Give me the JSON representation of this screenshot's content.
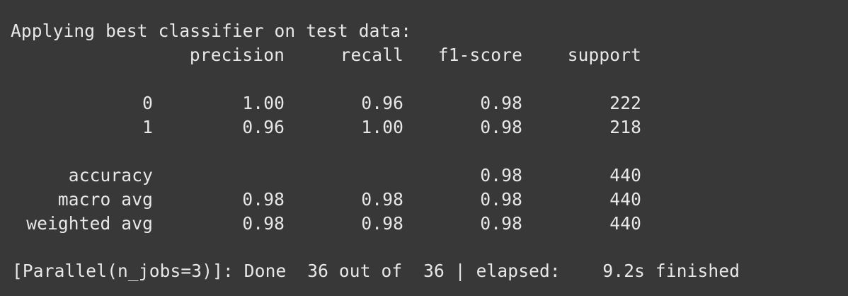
{
  "heading": "Applying best classifier on test data:",
  "report": {
    "columns": [
      "precision",
      "recall",
      "f1-score",
      "support"
    ],
    "rows": [
      {
        "label": "0",
        "precision": "1.00",
        "recall": "0.96",
        "f1": "0.98",
        "support": "222"
      },
      {
        "label": "1",
        "precision": "0.96",
        "recall": "1.00",
        "f1": "0.98",
        "support": "218"
      },
      {
        "label": "accuracy",
        "precision": "",
        "recall": "",
        "f1": "0.98",
        "support": "440"
      },
      {
        "label": "macro avg",
        "precision": "0.98",
        "recall": "0.98",
        "f1": "0.98",
        "support": "440"
      },
      {
        "label": "weighted avg",
        "precision": "0.98",
        "recall": "0.98",
        "f1": "0.98",
        "support": "440"
      }
    ]
  },
  "parallel_status": "[Parallel(n_jobs=3)]: Done  36 out of  36 | elapsed:    9.2s finished"
}
